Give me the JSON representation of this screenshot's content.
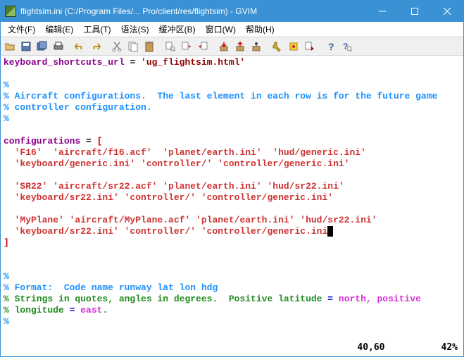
{
  "window": {
    "title": "flightsim.ini (C:/Program Files/... Pro/client/res/flightsim) - GVIM"
  },
  "menu": {
    "file": "文件(F)",
    "edit": "编辑(E)",
    "tools": "工具(T)",
    "syntax": "语法(S)",
    "buffers": "缓冲区(B)",
    "window": "窗口(W)",
    "help": "帮助(H)"
  },
  "toolbar": {
    "open": "open",
    "save": "save",
    "saveall": "save-all",
    "print": "print",
    "undo": "undo",
    "redo": "redo",
    "cut": "cut",
    "copy": "copy",
    "paste": "paste",
    "find": "find",
    "findnext": "find-next",
    "findprev": "find-prev",
    "loadsess": "load-session",
    "savesess": "save-session",
    "runscript": "run-script",
    "make": "make",
    "shell": "shell",
    "tagjump": "tag-jump",
    "help2": "help",
    "findhelp": "find-help"
  },
  "code": {
    "l1_key": "keyboard_shortcuts_url",
    "l1_eq": " = ",
    "l1_str": "'ug_flightsim.html'",
    "blank1": "",
    "c1": "%",
    "c2": "% Aircraft configurations.  The last element in each row is for the future game",
    "c3": "% controller configuration.",
    "c4": "%",
    "cfg_key": "configurations",
    "cfg_eq": " = ",
    "cfg_br": "[",
    "r1a": "  'F16'  'aircraft/f16.acf'  'planet/earth.ini'  'hud/generic.ini' ",
    "r1b": "  'keyboard/generic.ini' 'controller/' 'controller/generic.ini'",
    "blank2": "",
    "r2a": "  'SR22' 'aircraft/sr22.acf' 'planet/earth.ini' 'hud/sr22.ini' ",
    "r2b": "  'keyboard/sr22.ini' 'controller/' 'controller/generic.ini'",
    "blank3": "",
    "r3a": "  'MyPlane' 'aircraft/MyPlane.acf' 'planet/earth.ini' 'hud/sr22.ini' ",
    "r3b": "  'keyboard/sr22.ini' 'controller/' 'controller/generic.ini",
    "r3b_end": "'",
    "cfg_close": "]",
    "blank4": "",
    "blank5": "",
    "c5": "%",
    "c6": "% Format:  Code name runway lat lon hdg",
    "c7a": "% Strings in quotes, angles in degrees.  Positive latitude",
    "c7eq": " = ",
    "c7b": "north, positive",
    "c8a": "% longitude",
    "c8eq": " = ",
    "c8b": "east",
    "c8dot": ".",
    "c9": "%"
  },
  "status": {
    "position": "40,60",
    "percent": "42%"
  }
}
